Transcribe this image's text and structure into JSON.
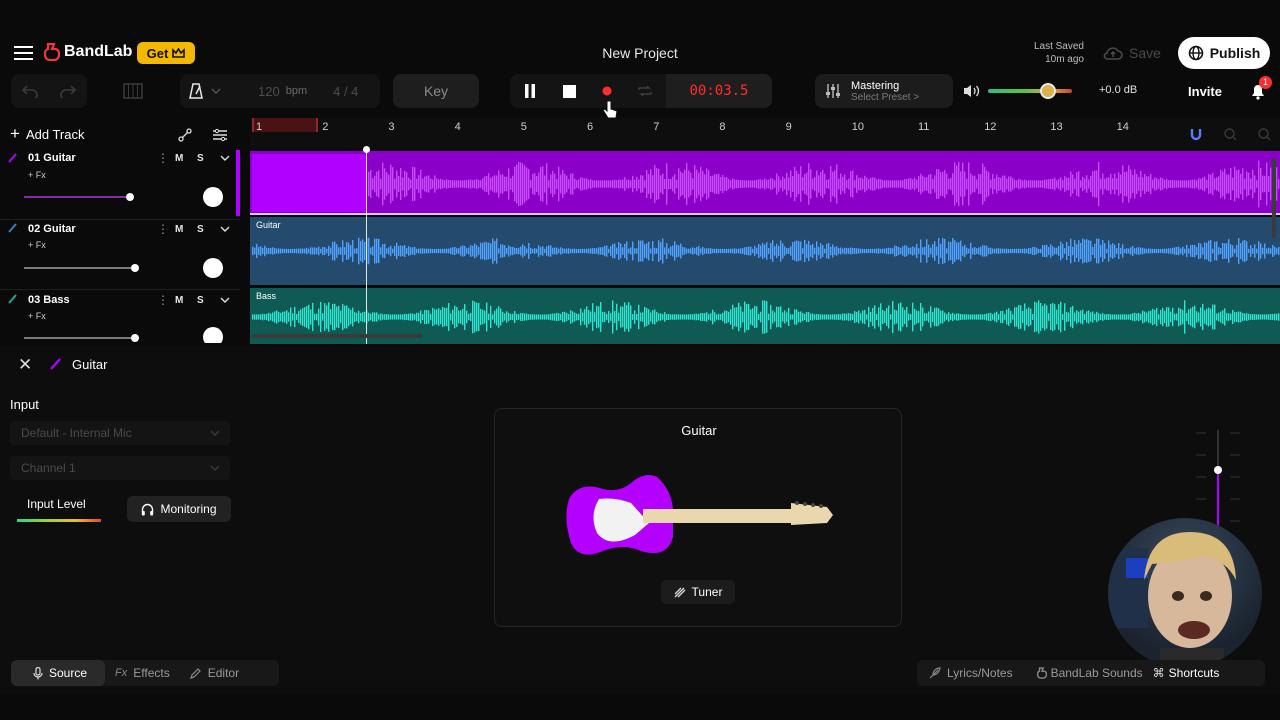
{
  "app": {
    "brand": "BandLab",
    "get_label": "Get",
    "project_title": "New Project",
    "last_saved_line1": "Last Saved",
    "last_saved_line2": "10m ago",
    "save_label": "Save",
    "publish_label": "Publish",
    "invite_label": "Invite",
    "notification_count": "1"
  },
  "transport": {
    "tempo_value": "120",
    "tempo_unit": "bpm",
    "time_signature": "4 / 4",
    "key_label": "Key",
    "time_display": "00:03.5",
    "mastering_title": "Mastering",
    "mastering_preset": "Select Preset >",
    "master_gain": "+0.0 dB",
    "master_volume": 0.72
  },
  "tracks_toolbar": {
    "add_track_label": "Add Track"
  },
  "ruler": {
    "bars": [
      "1",
      "2",
      "3",
      "4",
      "5",
      "6",
      "7",
      "8",
      "9",
      "10",
      "11",
      "12",
      "13",
      "14"
    ]
  },
  "tracks": [
    {
      "name": "01  Guitar",
      "fx": "+ Fx",
      "mute": "M",
      "solo": "S",
      "lane_label": "",
      "color": "#b000ff"
    },
    {
      "name": "02  Guitar",
      "fx": "+ Fx",
      "mute": "M",
      "solo": "S",
      "lane_label": "Guitar",
      "color": "#3a7fc4"
    },
    {
      "name": "03  Bass",
      "fx": "+ Fx",
      "mute": "M",
      "solo": "S",
      "lane_label": "Bass",
      "color": "#1fa89a"
    }
  ],
  "editor": {
    "track_title": "Guitar",
    "input_label": "Input",
    "input_device": "Default - Internal Mic",
    "input_channel": "Channel 1",
    "input_level_label": "Input Level",
    "monitoring_label": "Monitoring",
    "instrument_title": "Guitar",
    "tuner_label": "Tuner"
  },
  "bottom_tabs": {
    "source": "Source",
    "effects_prefix": "Fx",
    "effects": "Effects",
    "editor": "Editor",
    "lyrics": "Lyrics/Notes",
    "sounds": "BandLab Sounds",
    "shortcuts": "Shortcuts"
  },
  "colors": {
    "accent_purple": "#b000ff",
    "guitar_blue": "#3a7fc4",
    "bass_teal": "#1fa89a",
    "record_red": "#ff2e2e",
    "brand_red": "#f0393c",
    "get_yellow": "#f5b800"
  }
}
